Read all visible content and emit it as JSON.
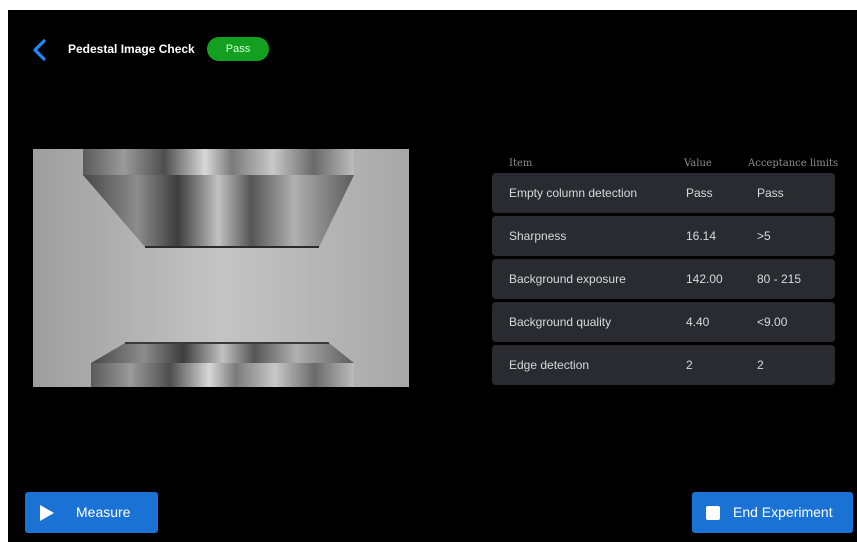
{
  "header": {
    "back_icon": "chevron-left-icon",
    "title": "Pedestal Image Check",
    "status": "Pass",
    "status_color": "#13a020"
  },
  "results": {
    "columns": [
      "Item",
      "Value",
      "Acceptance limits"
    ],
    "rows": [
      {
        "item": "Empty column detection",
        "value": "Pass",
        "limit": "Pass"
      },
      {
        "item": "Sharpness",
        "value": "16.14",
        "limit": ">5"
      },
      {
        "item": "Background exposure",
        "value": "142.00",
        "limit": "80 - 215"
      },
      {
        "item": "Background quality",
        "value": "4.40",
        "limit": "<9.00"
      },
      {
        "item": "Edge detection",
        "value": "2",
        "limit": "2"
      }
    ]
  },
  "footer": {
    "measure_label": "Measure",
    "measure_icon": "play-icon",
    "end_label": "End Experiment",
    "end_icon": "stop-icon",
    "accent": "#1a73d4"
  }
}
